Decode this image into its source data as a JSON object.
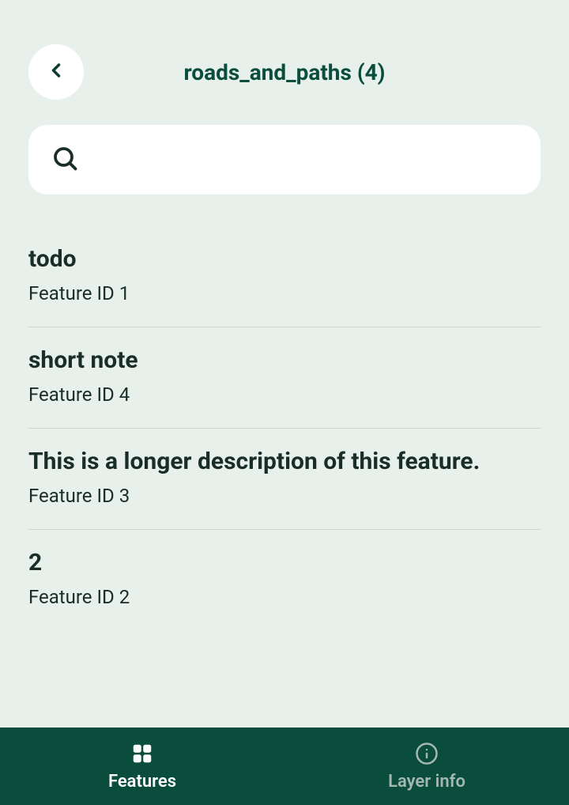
{
  "header": {
    "title": "roads_and_paths (4)"
  },
  "search": {
    "value": "",
    "placeholder": ""
  },
  "features": [
    {
      "title": "todo",
      "subtitle": "Feature ID 1"
    },
    {
      "title": "short note",
      "subtitle": "Feature ID 4"
    },
    {
      "title": "This is a longer description of this feature.",
      "subtitle": "Feature ID 3"
    },
    {
      "title": "2",
      "subtitle": "Feature ID 2"
    }
  ],
  "nav": {
    "features_label": "Features",
    "layer_info_label": "Layer info"
  }
}
